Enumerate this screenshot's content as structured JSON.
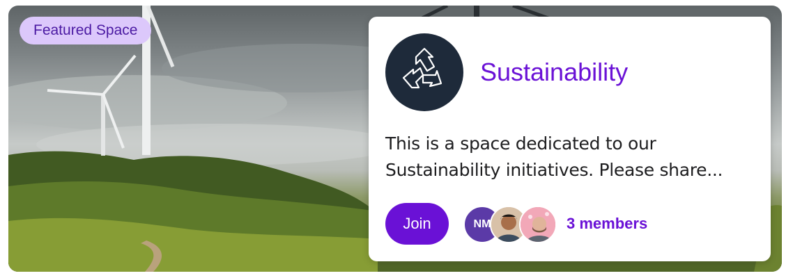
{
  "banner": {
    "badge_label": "Featured Space",
    "image_icon": "wind-turbine-landscape"
  },
  "space": {
    "title": "Sustainability",
    "logo_icon": "recycle-icon",
    "description_lines": [
      "This is a space dedicated to our",
      "Sustainability initiatives. Please share..."
    ],
    "join_label": "Join",
    "members": {
      "avatars": [
        {
          "initials": "NM",
          "color": "#5b3aa7"
        },
        {
          "initials": "",
          "color": "#c9b29c"
        },
        {
          "initials": "",
          "color": "#e27b96"
        }
      ],
      "count_label": "3 members"
    }
  },
  "colors": {
    "accent": "#6a11d6",
    "badge_bg": "#dcc8fb",
    "logo_bg": "#1e2a3a"
  }
}
